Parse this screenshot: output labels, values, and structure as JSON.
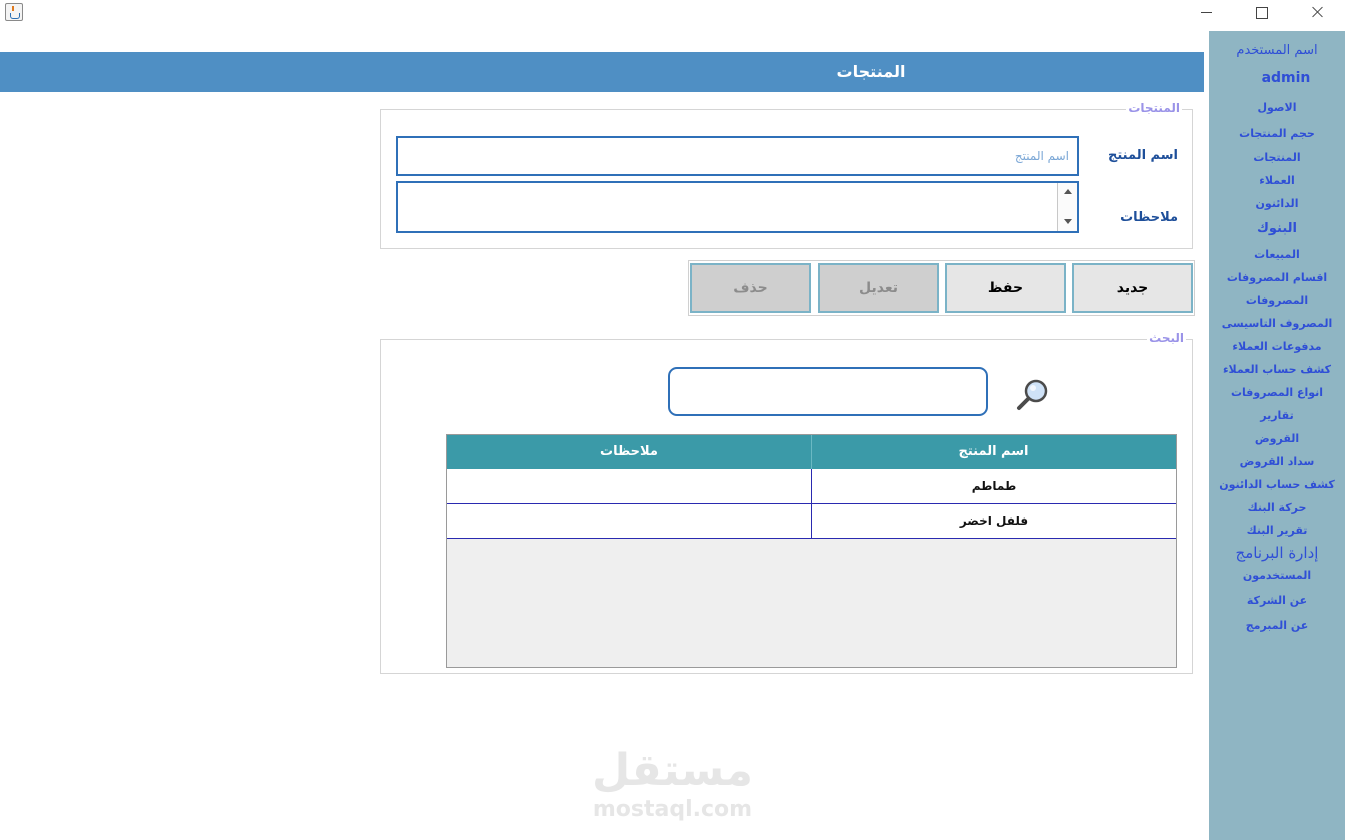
{
  "window": {
    "icon": "java-cup-icon",
    "controls": {
      "minimize": "minimize-icon",
      "maximize": "maximize-icon",
      "close": "close-icon"
    }
  },
  "header": {
    "title": "المنتجات"
  },
  "sidebar": {
    "user_label": "اسم المستخدم",
    "username": "admin",
    "items": [
      "الاصول",
      "حجم المنتجات",
      "المنتجات",
      "العملاء",
      "الدائنون",
      "البنوك",
      "المبيعات",
      "اقسام المصروفات",
      "المصروفات",
      "المصروف التاسيسى",
      "مدفوعات العملاء",
      "كشف حساب العملاء",
      "انواع المصروفات",
      "تقارير",
      "القروض",
      "سداد القروض",
      "كشف حساب الدائنون",
      "حركة البنك",
      "تقرير البنك",
      "إدارة البرنامج",
      "المستخدمون",
      "عن الشركة",
      "عن المبرمج"
    ]
  },
  "products_form": {
    "legend": "المنتجات",
    "name_label": "اسم المنتج",
    "name_placeholder": "اسم المنتج",
    "name_value": "",
    "notes_label": "ملاحظات",
    "notes_value": ""
  },
  "buttons": {
    "new": "جديد",
    "save": "حفظ",
    "edit": "تعديل",
    "delete": "حذف"
  },
  "search": {
    "legend": "البحث",
    "value": "",
    "icon": "magnifier-icon"
  },
  "table": {
    "columns": {
      "name": "اسم المنتج",
      "notes": "ملاحظات"
    },
    "rows": [
      {
        "name": "طماطم",
        "notes": ""
      },
      {
        "name": "فلفل اخضر",
        "notes": ""
      }
    ]
  },
  "watermark": {
    "arabic": "مستقل",
    "latin": "mostaql.com"
  },
  "colors": {
    "header": "#4f8fc4",
    "sidebar": "#8fb5c3",
    "sidebar_text": "#2f4fd6",
    "table_header": "#3b9aa8",
    "input_border": "#2f70b8"
  }
}
